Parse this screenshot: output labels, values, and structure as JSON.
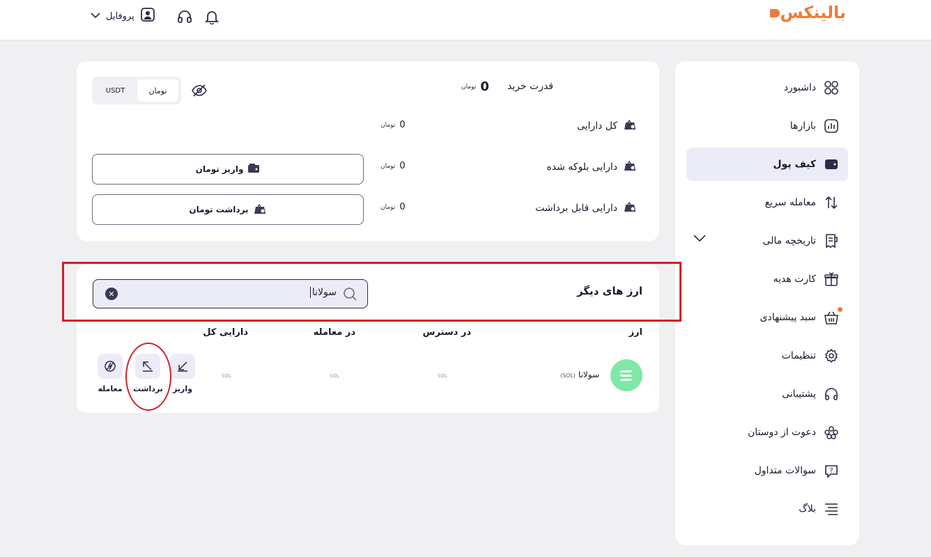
{
  "header": {
    "logo": "بالینکس",
    "profile_label": "پروفایل"
  },
  "sidebar": {
    "items": [
      {
        "label": "داشبورد",
        "icon": "grid-icon"
      },
      {
        "label": "بازارها",
        "icon": "chart-icon"
      },
      {
        "label": "کیف پول",
        "icon": "wallet-icon",
        "active": true
      },
      {
        "label": "معامله سریع",
        "icon": "swap-icon"
      },
      {
        "label": "تاریخچه مالی",
        "icon": "receipt-icon",
        "expandable": true
      },
      {
        "label": "کارت هدیه",
        "icon": "gift-icon"
      },
      {
        "label": "سبد پیشنهادی",
        "icon": "basket-icon",
        "badge": true
      },
      {
        "label": "تنظیمات",
        "icon": "gear-icon"
      },
      {
        "label": "پشتیبانی",
        "icon": "headset-icon"
      },
      {
        "label": "دعوت از دوستان",
        "icon": "users-icon"
      },
      {
        "label": "سوالات متداول",
        "icon": "question-icon"
      },
      {
        "label": "بلاگ",
        "icon": "menu-lines-icon"
      }
    ]
  },
  "balance": {
    "buying_power_label": "قدرت خرید",
    "buying_power_value": "0",
    "currency_unit": "تومان",
    "toggle": {
      "toman": "تومان",
      "usdt": "USDT"
    },
    "rows": [
      {
        "label": "کل دارایی",
        "value": "0"
      },
      {
        "label": "دارایی بلوکه شده",
        "value": "0"
      },
      {
        "label": "دارایی قابل برداشت",
        "value": "0"
      }
    ],
    "deposit_button": "واریز تومان",
    "withdraw_button": "برداشت تومان"
  },
  "other_assets": {
    "title": "ارز های دیگر",
    "search_value": "سولانا",
    "columns": {
      "currency": "ارز",
      "available": "در دسترس",
      "in_trade": "در معامله",
      "total": "دارایی کل"
    },
    "row": {
      "name": "سولانا",
      "symbol": "(SOL)",
      "available": "SOL",
      "in_trade": "SOL",
      "total": "SOL"
    },
    "actions": {
      "deposit": "واریز",
      "withdraw": "برداشت",
      "trade": "معامله"
    }
  },
  "colors": {
    "accent": "#f07a3a",
    "active_bg": "#ecebf8",
    "annotation": "#d0202a",
    "coin": "#7ee8a8"
  }
}
